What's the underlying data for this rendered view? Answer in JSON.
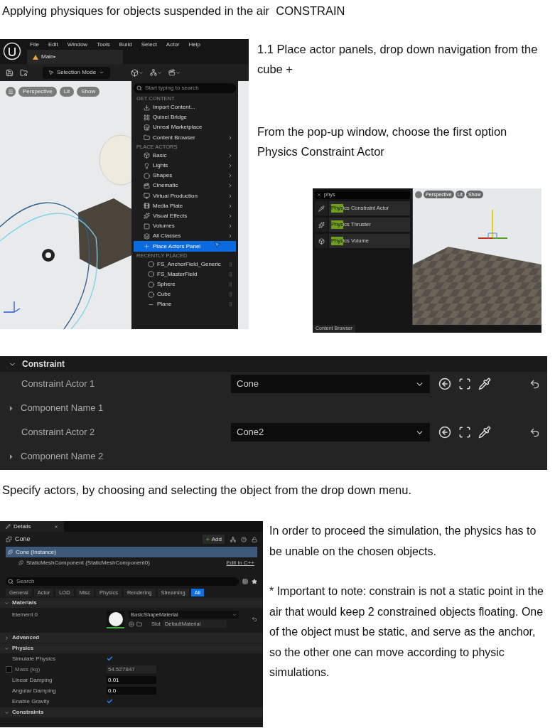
{
  "title": "Applying physiques for objects suspended in the air  CONSTRAIN",
  "editor": {
    "menu": [
      "File",
      "Edit",
      "Window",
      "Tools",
      "Build",
      "Select",
      "Actor",
      "Help"
    ],
    "tab": "Main•",
    "mode": "Selection Mode",
    "viewport_buttons": [
      "Perspective",
      "Lit",
      "Show"
    ],
    "dropdown": {
      "placeholder": "Start typing to search",
      "sections": [
        {
          "heading": "GET CONTENT",
          "items": [
            {
              "label": "Import Content...",
              "submenu": false,
              "selected": false
            },
            {
              "label": "Quixel Bridge",
              "submenu": false,
              "selected": false
            },
            {
              "label": "Unreal Marketplace",
              "submenu": false,
              "selected": false
            },
            {
              "label": "Content Browser",
              "submenu": true,
              "selected": false
            }
          ]
        },
        {
          "heading": "PLACE ACTORS",
          "items": [
            {
              "label": "Basic",
              "submenu": true,
              "selected": false
            },
            {
              "label": "Lights",
              "submenu": true,
              "selected": false
            },
            {
              "label": "Shapes",
              "submenu": true,
              "selected": false
            },
            {
              "label": "Cinematic",
              "submenu": true,
              "selected": false
            },
            {
              "label": "Virtual Production",
              "submenu": true,
              "selected": false
            },
            {
              "label": "Media Plate",
              "submenu": true,
              "selected": false
            },
            {
              "label": "Visual Effects",
              "submenu": true,
              "selected": false
            },
            {
              "label": "Volumes",
              "submenu": true,
              "selected": false
            },
            {
              "label": "All Classes",
              "submenu": true,
              "selected": false
            },
            {
              "label": "Place Actors Panel",
              "submenu": false,
              "selected": true
            }
          ]
        },
        {
          "heading": "RECENTLY PLACED",
          "items": [
            {
              "label": "FS_AnchorField_Generic",
              "submenu": false,
              "selected": false
            },
            {
              "label": "FS_MasterField",
              "submenu": false,
              "selected": false
            },
            {
              "label": "Sphere",
              "submenu": false,
              "selected": false
            },
            {
              "label": "Cube",
              "submenu": false,
              "selected": false
            },
            {
              "label": "Plane",
              "submenu": false,
              "selected": false
            }
          ]
        }
      ]
    }
  },
  "steps": [
    "1.1 Place actor panels, drop down navigation from the cube +",
    "From the pop-up window, choose the first option Physics Constraint Actor"
  ],
  "place_actors": {
    "search": "phys",
    "results": [
      {
        "match": "Phys",
        "rest": "ics Constraint Actor"
      },
      {
        "match": "Phys",
        "rest": "ics Thruster"
      },
      {
        "match": "Phys",
        "rest": "ics Volume"
      }
    ],
    "viewport_buttons": [
      "Perspective",
      "Lit",
      "Show"
    ],
    "bottom_tab": "Content Browser"
  },
  "constraint_panel": {
    "heading": "Constraint",
    "rows": [
      {
        "kind": "actor",
        "label": "Constraint Actor 1",
        "value": "Cone"
      },
      {
        "kind": "component",
        "label": "Component Name 1",
        "expanded": false
      },
      {
        "kind": "actor",
        "label": "Constraint Actor 2",
        "value": "Cone2"
      },
      {
        "kind": "component",
        "label": "Component Name 2",
        "expanded": false
      }
    ]
  },
  "caption": "Specify actors, by choosing and selecting the object from the drop down menu.",
  "details": {
    "tab": "Details",
    "actor": "Cone",
    "add_button": "Add",
    "components": [
      {
        "label": "Cone (Instance)",
        "selected": true
      },
      {
        "label": "StaticMeshComponent (StaticMeshComponent0)",
        "selected": false,
        "link": "Edit in C++"
      }
    ],
    "search_placeholder": "Search",
    "filters": [
      {
        "label": "General",
        "selected": false
      },
      {
        "label": "Actor",
        "selected": false
      },
      {
        "label": "LOD",
        "selected": false
      },
      {
        "label": "Misc",
        "selected": false
      },
      {
        "label": "Physics",
        "selected": false
      },
      {
        "label": "Rendering",
        "selected": false
      },
      {
        "label": "Streaming",
        "selected": false
      },
      {
        "label": "All",
        "selected": true
      }
    ],
    "rows": [
      {
        "kind": "section",
        "label": "Materials",
        "expanded": true
      },
      {
        "kind": "material",
        "label": "Element 0",
        "material": "BasicShapeMaterial",
        "slot_label": "Slot",
        "slot": "DefaultMaterial"
      },
      {
        "kind": "section",
        "label": "Advanced",
        "expanded": false
      },
      {
        "kind": "section",
        "label": "Physics",
        "expanded": true
      },
      {
        "kind": "checkbox",
        "label": "Simulate Physics",
        "checked": true
      },
      {
        "kind": "number",
        "label": "Mass (kg)",
        "value": "54.527847",
        "disabled": true,
        "override": false
      },
      {
        "kind": "number",
        "label": "Linear Damping",
        "value": "0.01",
        "disabled": false
      },
      {
        "kind": "number",
        "label": "Angular Damping",
        "value": "0.0",
        "disabled": false
      },
      {
        "kind": "checkbox",
        "label": "Enable Gravity",
        "checked": true
      },
      {
        "kind": "section",
        "label": "Constraints",
        "expanded": true
      }
    ]
  },
  "notes": [
    "In order to proceed the simulation, the physics has to be unable on the chosen objects.",
    "* Important to note: constrain is not a static point in the air that would keep 2 constrained objects floating. One of the object must be static, and serve as the anchor, so the other one can move according to physic simulations."
  ]
}
